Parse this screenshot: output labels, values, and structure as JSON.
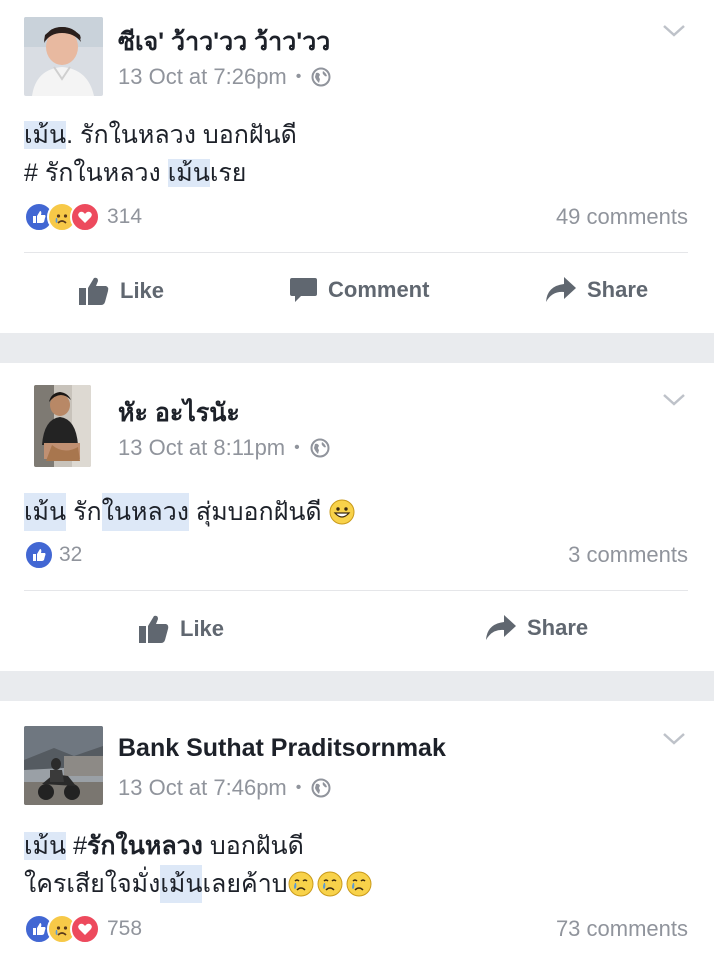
{
  "posts": [
    {
      "author": "ซีเจ' ว้าว'วว ว้าว'วว",
      "time": "13 Oct at 7:26pm",
      "dot": "•",
      "text_lines": [
        [
          {
            "t": "เม้น",
            "hl": true
          },
          {
            "t": ". รักในหลวง บอกฝันดี",
            "hl": false
          }
        ],
        [
          {
            "t": "# รักในหลวง ",
            "hl": false
          },
          {
            "t": "เม้น",
            "hl": true
          },
          {
            "t": "เรย",
            "hl": false
          }
        ]
      ],
      "reaction_count": "314",
      "comments": "49 comments",
      "actions": {
        "like": "Like",
        "comment": "Comment",
        "share": "Share"
      }
    },
    {
      "author": "หัะ อะไรนัะ",
      "time": "13 Oct at 8:11pm",
      "dot": "•",
      "text_lines": [
        [
          {
            "t": "เม้น",
            "hl": true
          },
          {
            "t": " รัก",
            "hl": false
          },
          {
            "t": "ในหลวง",
            "hl": true
          },
          {
            "t": " สุ่มบอกฝันดี ",
            "hl": false
          }
        ]
      ],
      "reaction_count": "32",
      "comments": "3 comments",
      "actions": {
        "like": "Like",
        "share": "Share"
      }
    },
    {
      "author": "Bank Suthat Praditsornmak",
      "time": "13 Oct at 7:46pm",
      "dot": "•",
      "text_lines": [
        [
          {
            "t": "เม้น",
            "hl": true
          },
          {
            "t": " #",
            "hl": false
          },
          {
            "t": "รักในหลวง",
            "hl": false,
            "bold": true
          },
          {
            "t": " บอกฝันดี",
            "hl": false
          }
        ],
        [
          {
            "t": "ใครเสียใจมั่ง",
            "hl": false
          },
          {
            "t": "เม้น",
            "hl": true
          },
          {
            "t": "เลยค้าบ",
            "hl": false
          }
        ]
      ],
      "reaction_count": "758",
      "comments": "73 comments"
    }
  ],
  "icons": {
    "globe": "globe-icon",
    "chevron": "chevron-down-icon",
    "like": "thumbs-up-icon",
    "comment": "comment-bubble-icon",
    "share": "share-arrow-icon",
    "emoji_grin": "grinning-emoji-icon",
    "emoji_cry": "crying-emoji-icon"
  },
  "colors": {
    "fb_blue": "#4267d3",
    "sad_yellow": "#f7c948",
    "love_red": "#ed4a5d",
    "meta_grey": "#90949c",
    "action_grey": "#606770",
    "separator": "#e9ebee",
    "highlight": "#dde8f7"
  }
}
